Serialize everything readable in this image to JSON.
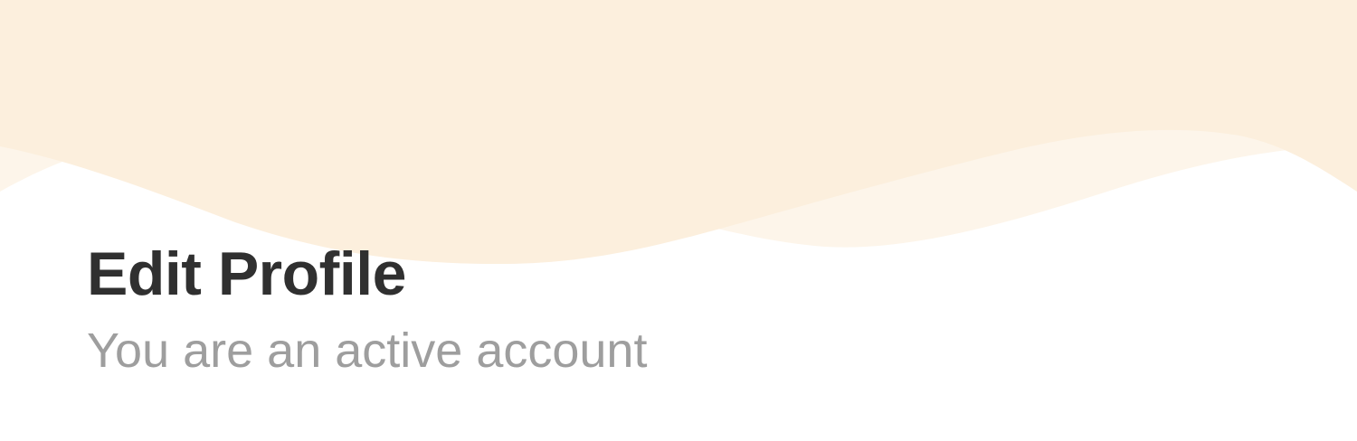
{
  "header": {
    "title": "Edit Profile",
    "subtitle": "You are an active account"
  },
  "theme": {
    "header_wave_primary": "#fcefdd",
    "header_wave_secondary": "#fdf5ea",
    "title_color": "#303030",
    "subtitle_color": "#9e9e9e",
    "background": "#ffffff"
  }
}
